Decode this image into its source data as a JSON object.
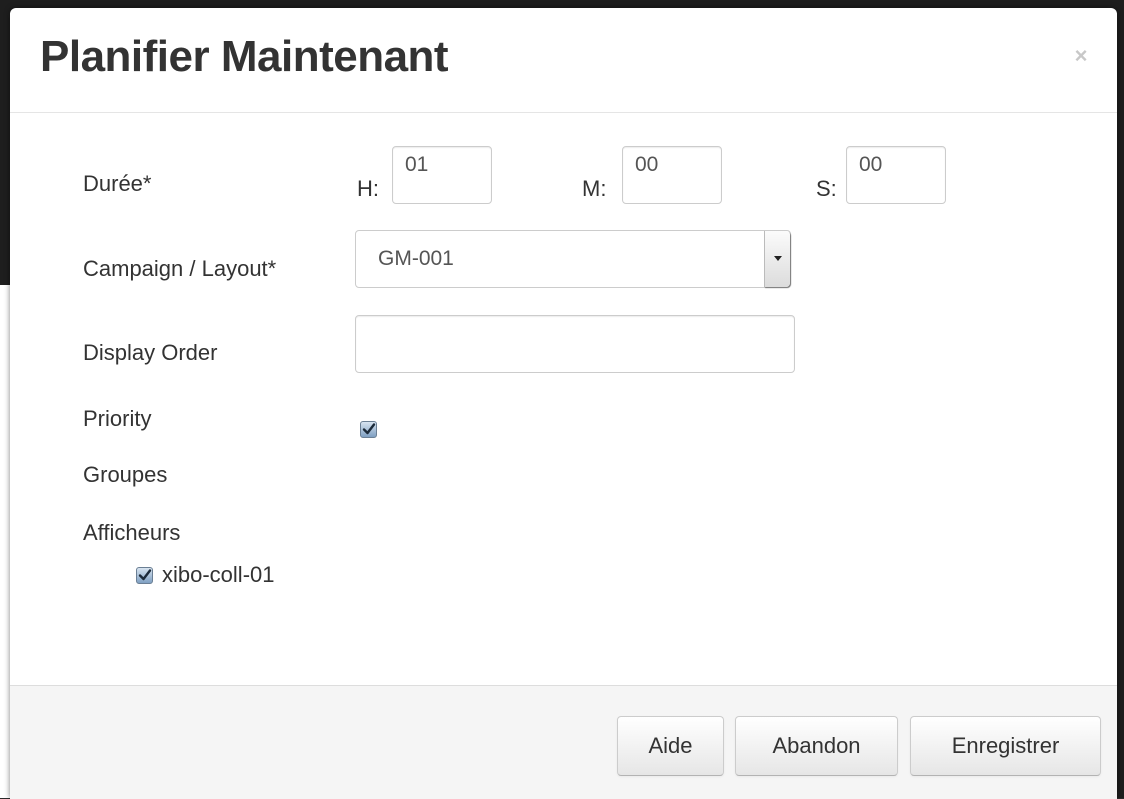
{
  "modal": {
    "title": "Planifier Maintenant",
    "close_glyph": "×"
  },
  "form": {
    "duration": {
      "label": "Durée*",
      "hours_label": "H:",
      "hours_value": "01",
      "minutes_label": "M:",
      "minutes_value": "00",
      "seconds_label": "S:",
      "seconds_value": "00"
    },
    "campaign": {
      "label": "Campaign / Layout*",
      "selected": "GM-001"
    },
    "display_order": {
      "label": "Display Order",
      "value": ""
    },
    "priority": {
      "label": "Priority",
      "checked": true
    },
    "groups": {
      "label": "Groupes"
    },
    "displays": {
      "label": "Afficheurs",
      "items": [
        {
          "label": "xibo-coll-01",
          "checked": true
        }
      ]
    }
  },
  "footer": {
    "help_label": "Aide",
    "cancel_label": "Abandon",
    "save_label": "Enregistrer"
  },
  "icons": {
    "close": "close-icon",
    "checkbox": "checkmark-icon",
    "select": "chevron-down-icon"
  }
}
